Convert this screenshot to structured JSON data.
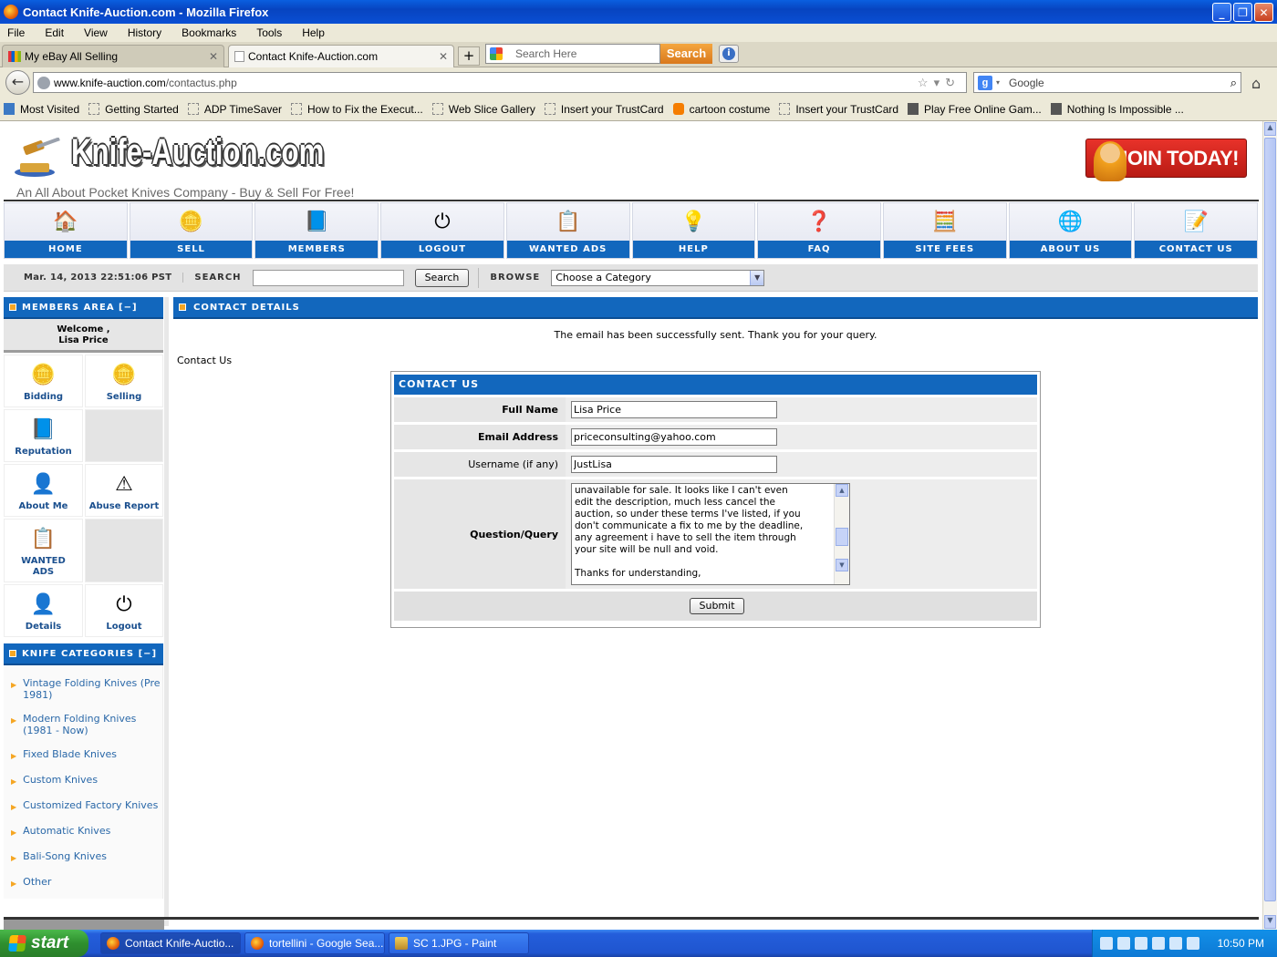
{
  "window": {
    "title": "Contact Knife-Auction.com - Mozilla Firefox",
    "controls": [
      "_",
      "❐",
      "✕"
    ]
  },
  "menu": [
    "File",
    "Edit",
    "View",
    "History",
    "Bookmarks",
    "Tools",
    "Help"
  ],
  "tabs": [
    {
      "label": "My eBay All Selling"
    },
    {
      "label": "Contact Knife-Auction.com"
    }
  ],
  "toolbar_search": {
    "placeholder": "Search Here",
    "button": "Search"
  },
  "address": {
    "domain": "www.knife-auction.com",
    "path": "/contactus.php"
  },
  "search_engine": {
    "placeholder": "Google"
  },
  "bookmarks": [
    {
      "label": "Most Visited",
      "icon": "blue"
    },
    {
      "label": "Getting Started",
      "icon": "page"
    },
    {
      "label": "ADP TimeSaver",
      "icon": "page"
    },
    {
      "label": "How to Fix the Execut...",
      "icon": "page"
    },
    {
      "label": "Web Slice Gallery",
      "icon": "page"
    },
    {
      "label": "Insert your TrustCard",
      "icon": "page"
    },
    {
      "label": "cartoon costume",
      "icon": "orange"
    },
    {
      "label": "Insert your TrustCard",
      "icon": "page"
    },
    {
      "label": "Play Free Online Gam...",
      "icon": "dark"
    },
    {
      "label": "Nothing Is Impossible ...",
      "icon": "dark"
    }
  ],
  "site": {
    "logo_text": "Knife-Auction.com",
    "tagline": "An All About Pocket Knives Company - Buy & Sell For Free!",
    "join_label": "JOIN TODAY!"
  },
  "nav": [
    {
      "label": "HOME",
      "icon": "🏠"
    },
    {
      "label": "SELL",
      "icon": "🪙"
    },
    {
      "label": "MEMBERS",
      "icon": "📘"
    },
    {
      "label": "LOGOUT",
      "icon": "⏻"
    },
    {
      "label": "WANTED ADS",
      "icon": "📋"
    },
    {
      "label": "HELP",
      "icon": "💡"
    },
    {
      "label": "FAQ",
      "icon": "❓"
    },
    {
      "label": "SITE FEES",
      "icon": "🧮"
    },
    {
      "label": "ABOUT US",
      "icon": "🌐"
    },
    {
      "label": "CONTACT US",
      "icon": "📝"
    }
  ],
  "search_strip": {
    "datetime": "Mar. 14, 2013 22:51:06 PST",
    "search_label": "SEARCH",
    "search_button": "Search",
    "browse_label": "BROWSE",
    "category_selected": "Choose a Category"
  },
  "members": {
    "header": "MEMBERS AREA [−]",
    "welcome_line1": "Welcome ,",
    "welcome_name": "Lisa Price",
    "items": [
      {
        "label": "Bidding",
        "icon": "🪙"
      },
      {
        "label": "Selling",
        "icon": "🪙"
      },
      {
        "label": "Reputation",
        "icon": "📘"
      },
      {
        "label": "",
        "icon": ""
      },
      {
        "label": "About Me",
        "icon": "👤"
      },
      {
        "label": "Abuse Report",
        "icon": "⚠"
      },
      {
        "label": "WANTED ADS",
        "icon": "📋"
      },
      {
        "label": "",
        "icon": ""
      },
      {
        "label": "Details",
        "icon": "👤"
      },
      {
        "label": "Logout",
        "icon": "⏻"
      }
    ]
  },
  "categories": {
    "header": "KNIFE CATEGORIES [−]",
    "items": [
      "Vintage Folding Knives (Pre 1981)",
      "Modern Folding Knives (1981 - Now)",
      "Fixed Blade Knives",
      "Custom Knives",
      "Customized Factory Knives",
      "Automatic Knives",
      "Bali-Song Knives",
      "Other"
    ]
  },
  "content": {
    "header": "CONTACT DETAILS",
    "success_message": "The email has been successfully sent. Thank you for your query.",
    "contact_us_label": "Contact Us",
    "form": {
      "title": "CONTACT US",
      "full_name_label": "Full Name",
      "full_name_value": "Lisa Price",
      "email_label": "Email Address",
      "email_value": "priceconsulting@yahoo.com",
      "username_label": "Username (if any)",
      "username_value": "JustLisa",
      "query_label": "Question/Query",
      "query_value": "unavailable for sale. It looks like I can't even\nedit the description, much less cancel the\nauction, so under these terms I've listed, if you\ndon't communicate a fix to me by the deadline,\nany agreement i have to sell the item through\nyour site will be null and void.\n\nThanks for understanding,",
      "submit_label": "Submit"
    }
  },
  "taskbar": {
    "start_label": "start",
    "items": [
      {
        "label": "Contact Knife-Auctio...",
        "icon": "firefox"
      },
      {
        "label": "tortellini - Google Sea...",
        "icon": "firefox"
      },
      {
        "label": "SC 1.JPG - Paint",
        "icon": "paint"
      }
    ],
    "clock": "10:50 PM"
  }
}
